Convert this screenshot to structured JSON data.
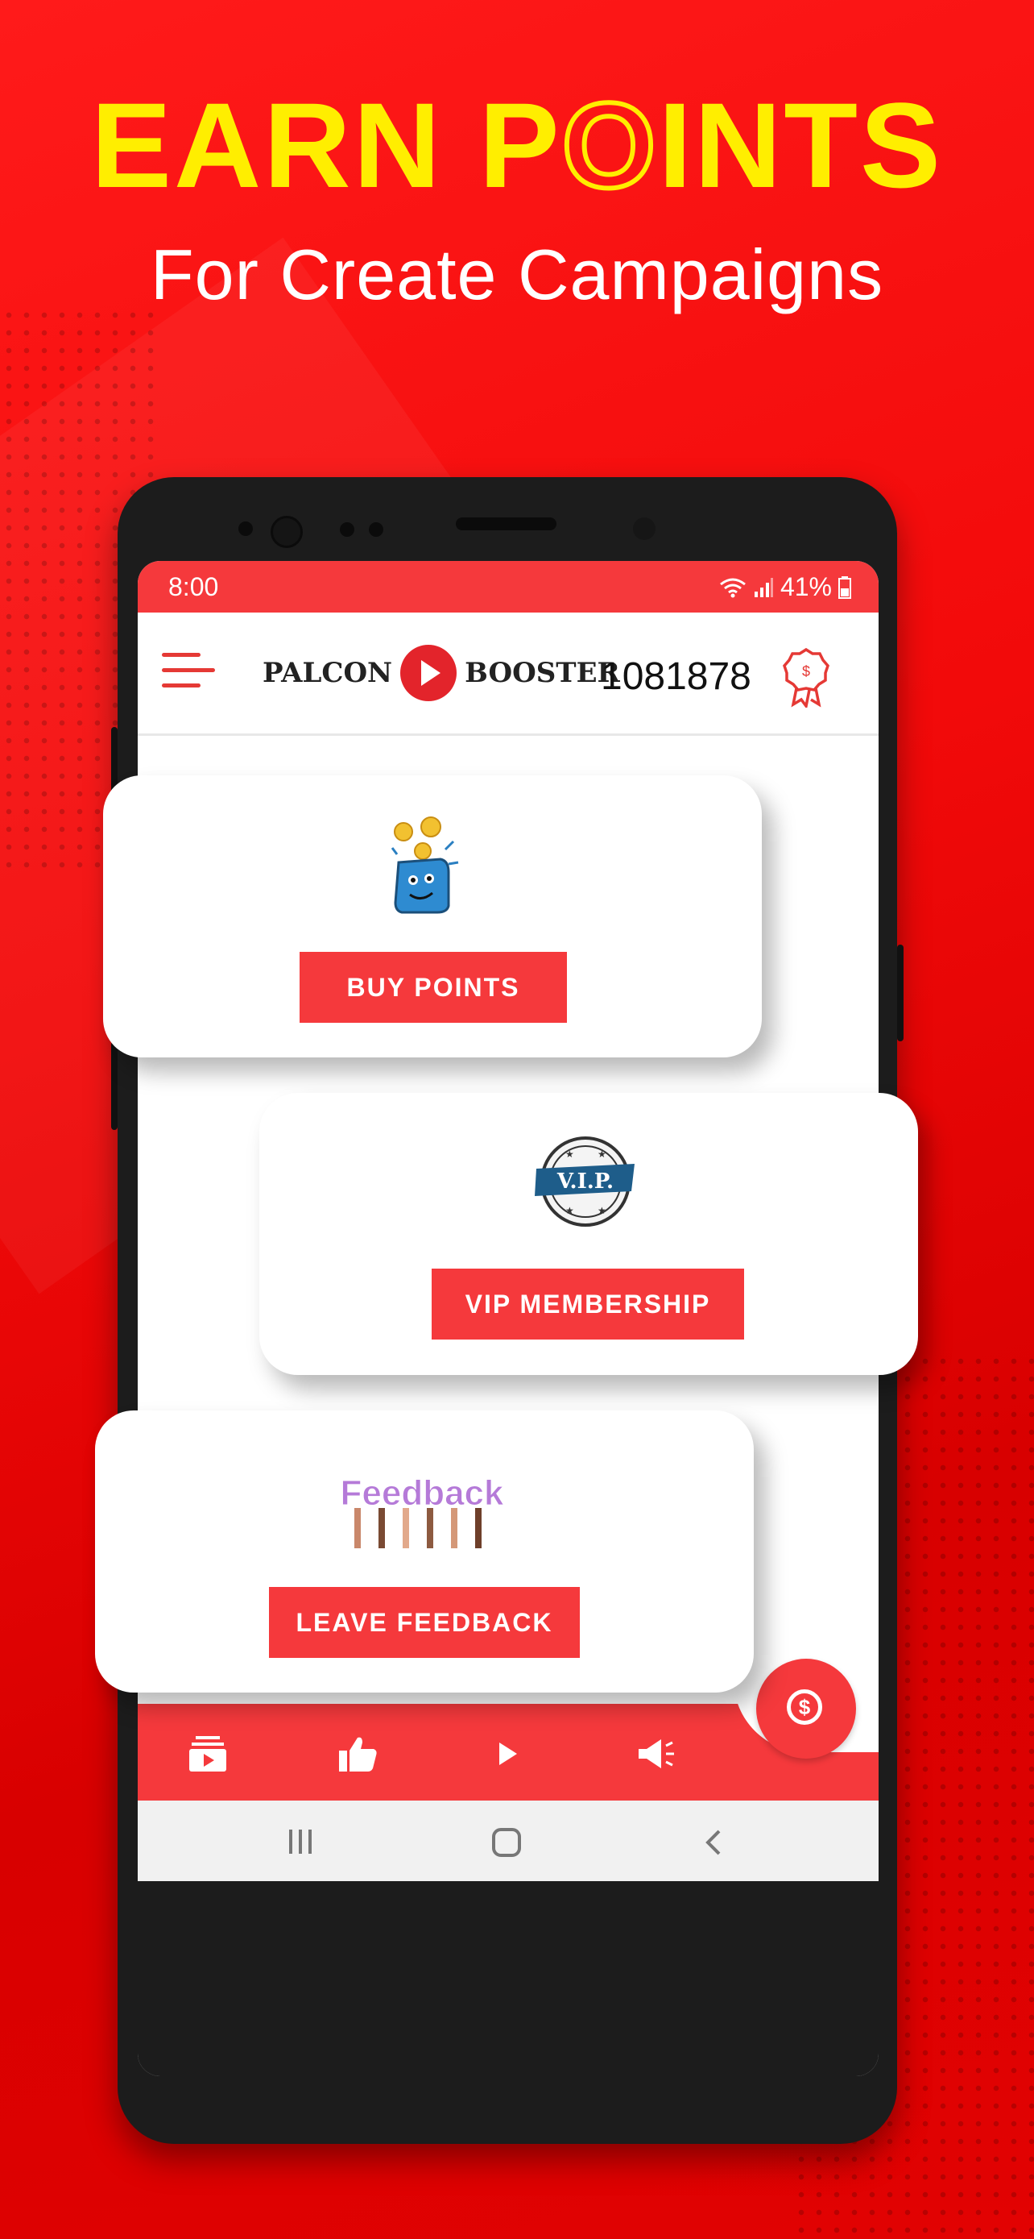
{
  "promo": {
    "headline_left": "EARN P",
    "headline_ring_letter": "O",
    "headline_right": "INTS",
    "subheadline": "For Create Campaigns"
  },
  "status_bar": {
    "time": "8:00",
    "battery": "41%"
  },
  "app_bar": {
    "logo_left": "PALCON",
    "logo_right": "BOOSTER",
    "points_balance": "1081878"
  },
  "cards": {
    "buy_points": {
      "label": "BUY POINTS"
    },
    "vip": {
      "label": "VIP MEMBERSHIP",
      "seal_text": "V.I.P."
    },
    "feedback": {
      "label": "LEAVE FEEDBACK",
      "sign_text": "Feedback"
    }
  },
  "bottom_nav": {
    "fab_symbol": "$"
  },
  "colors": {
    "brand_red": "#f5393c",
    "headline_yellow": "#ffee00",
    "background_red": "#f20a0a"
  },
  "icons": {
    "nav": [
      "video-stack-icon",
      "thumbs-up-icon",
      "play-icon",
      "megaphone-icon"
    ],
    "app_bar": [
      "hamburger-menu-icon",
      "reward-badge-icon"
    ]
  }
}
